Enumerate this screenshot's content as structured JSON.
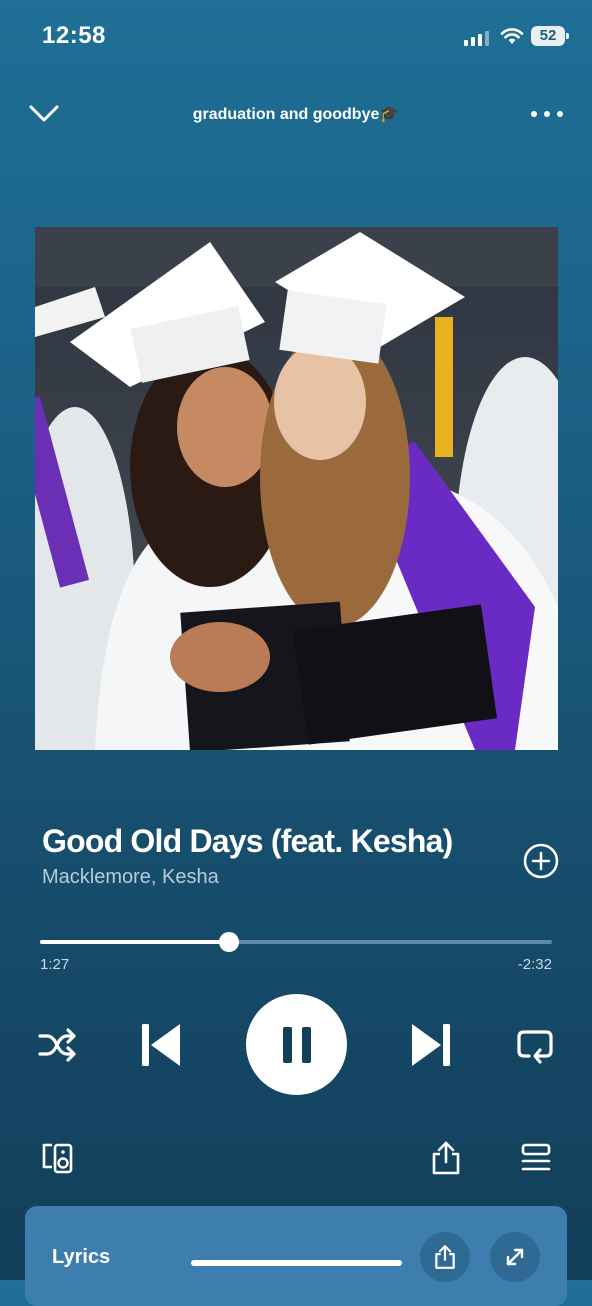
{
  "status_bar": {
    "time": "12:58",
    "battery": "52"
  },
  "header": {
    "playlist_title": "graduation and goodbye🎓"
  },
  "track": {
    "title": "Good Old Days (feat. Kesha)",
    "artists": "Macklemore, Kesha",
    "elapsed": "1:27",
    "remaining": "-2:32",
    "progress": 0.37
  },
  "lyrics": {
    "label": "Lyrics"
  },
  "icons": {
    "collapse": "chevron-down-icon",
    "more": "more-horizontal-icon",
    "add": "add-circle-icon",
    "shuffle": "shuffle-icon",
    "previous": "skip-previous-icon",
    "pause": "pause-icon",
    "next": "skip-next-icon",
    "repeat": "repeat-icon",
    "devices": "connect-device-icon",
    "share": "share-icon",
    "queue": "queue-icon",
    "expand": "expand-icon"
  },
  "colors": {
    "background_top": "#1f6f96",
    "background_bottom": "#123f5a",
    "lyrics_card": "#3d7eae",
    "secondary_text": "#b7cbd8"
  }
}
